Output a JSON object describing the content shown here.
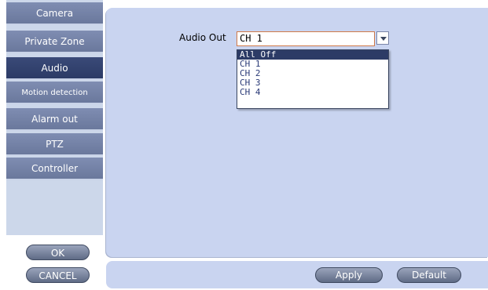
{
  "sidebar": {
    "items": [
      {
        "label": "Camera",
        "active": false
      },
      {
        "label": "Private Zone",
        "active": false
      },
      {
        "label": "Audio",
        "active": true
      },
      {
        "label": "Motion detection",
        "active": false
      },
      {
        "label": "Alarm out",
        "active": false
      },
      {
        "label": "PTZ",
        "active": false
      },
      {
        "label": "Controller",
        "active": false
      }
    ],
    "ok_label": "OK",
    "cancel_label": "CANCEL"
  },
  "main": {
    "audio_out_label": "Audio Out",
    "audio_out_value": "CH 1",
    "options": [
      "All Off",
      "CH 1",
      "CH 2",
      "CH 3",
      "CH 4"
    ],
    "highlighted_option": "All Off"
  },
  "footer": {
    "apply_label": "Apply",
    "default_label": "Default"
  },
  "colors": {
    "panel_bg": "#c9d4f0",
    "nav_active": "#2c3b66",
    "nav_normal": "#7f8db2",
    "select_border": "#d07a4a"
  }
}
